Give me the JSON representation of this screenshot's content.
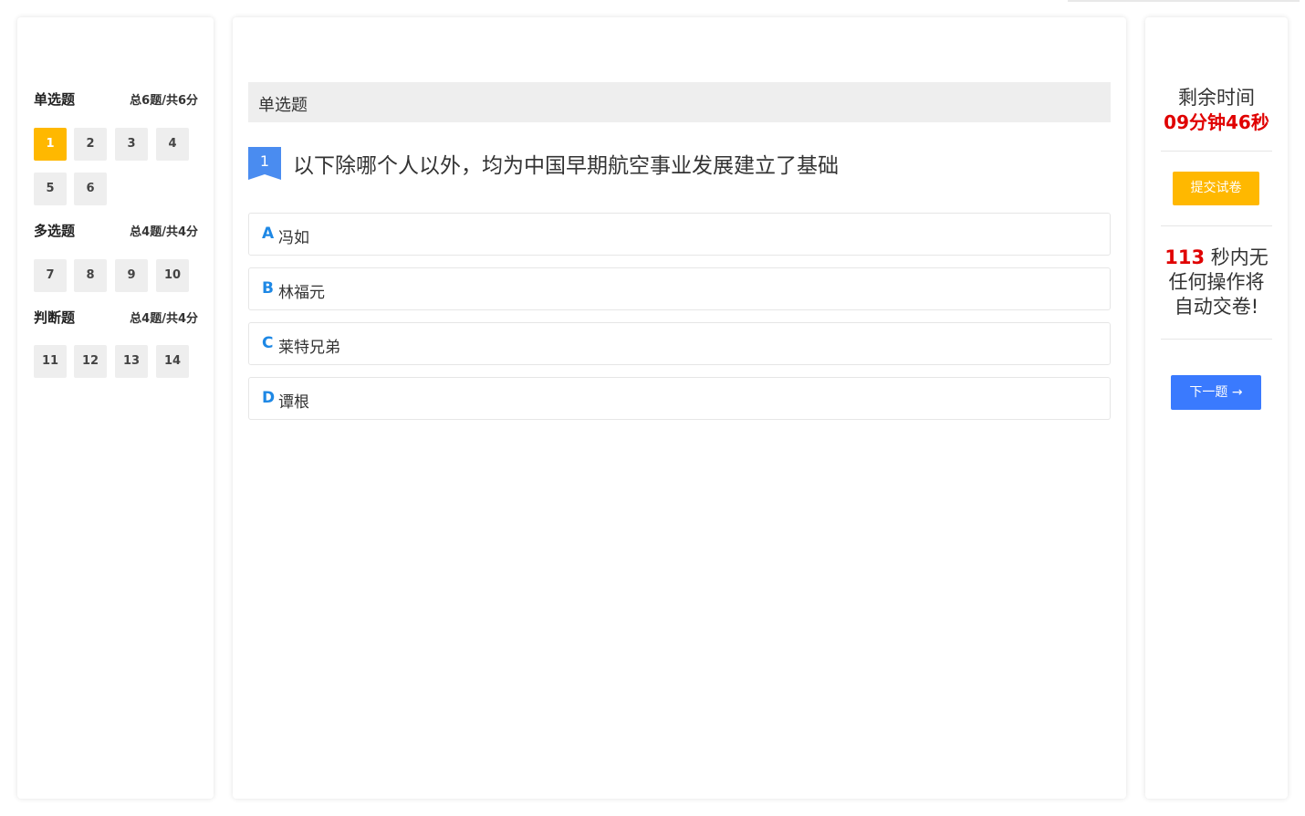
{
  "navigator": {
    "sections": [
      {
        "title": "单选题",
        "count": "总6题/共6分",
        "questions": [
          "1",
          "2",
          "3",
          "4",
          "5",
          "6"
        ],
        "active": "1"
      },
      {
        "title": "多选题",
        "count": "总4题/共4分",
        "questions": [
          "7",
          "8",
          "9",
          "10"
        ]
      },
      {
        "title": "判断题",
        "count": "总4题/共4分",
        "questions": [
          "11",
          "12",
          "13",
          "14"
        ]
      }
    ]
  },
  "main": {
    "type_label": "单选题",
    "question_number": "1",
    "question_text": "以下除哪个人以外，均为中国早期航空事业发展建立了基础",
    "options": [
      {
        "letter": "A",
        "text": "冯如"
      },
      {
        "letter": "B",
        "text": "林福元"
      },
      {
        "letter": "C",
        "text": "莱特兄弟"
      },
      {
        "letter": "D",
        "text": "谭根"
      }
    ]
  },
  "sidebar": {
    "timer_label": "剩余时间",
    "timer_value": "09分钟46秒",
    "submit_label": "提交试卷",
    "idle_seconds": "113",
    "idle_text": " 秒内无任何操作将自动交卷!",
    "next_label": "下一题 →"
  },
  "colors": {
    "accent_yellow": "#ffb800",
    "accent_blue": "#3a7afe",
    "option_letter": "#1e88e5",
    "alert_red": "#e00000"
  }
}
